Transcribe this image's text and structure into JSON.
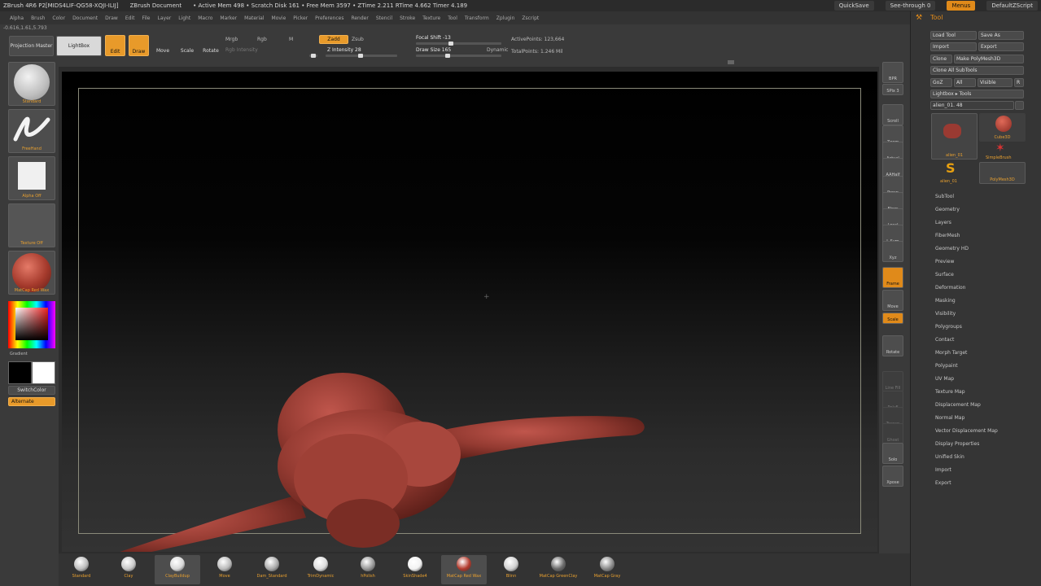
{
  "titlebar": {
    "app": "ZBrush 4R6 P2[MIDS4LIF-QG58-XQJI-ILIJ]",
    "doc": "ZBrush Document",
    "stats": "• Active Mem 498 • Scratch Disk 161 • Free Mem 3597 • ZTime 2.211 RTime 4.662 Timer 4.189",
    "quicksave": "QuickSave",
    "seethrough": "See-through 0",
    "menus": "Menus",
    "script": "DefaultZScript"
  },
  "menubar": [
    "Alpha",
    "Brush",
    "Color",
    "Document",
    "Draw",
    "Edit",
    "File",
    "Layer",
    "Light",
    "Macro",
    "Marker",
    "Material",
    "Movie",
    "Picker",
    "Preferences",
    "Render",
    "Stencil",
    "Stroke",
    "Texture",
    "Tool",
    "Transform",
    "Zplugin",
    "Zscript"
  ],
  "coords": "-0.616,1.61,5.793",
  "shelf": {
    "projection_master": "Projection Master",
    "lightbox": "LightBox",
    "edit": "Edit",
    "draw": "Draw",
    "move": "Move",
    "scale": "Scale",
    "rotate": "Rotate",
    "mrgb": "Mrgb",
    "rgb": "Rgb",
    "m": "M",
    "rgb_intensity": "Rgb Intensity",
    "zadd": "Zadd",
    "zsub": "Zsub",
    "z_intensity": "Z Intensity 28",
    "focal_shift": "Focal Shift -13",
    "draw_size": "Draw Size 165",
    "dynamic": "Dynamic",
    "active_points": "ActivePoints: 123,664",
    "total_points": "TotalPoints: 1.246 Mil"
  },
  "left": {
    "brush": "Standard",
    "stroke": "FreeHand",
    "alpha": "Alpha Off",
    "texture": "Texture Off",
    "material": "MatCap Red Wax",
    "gradient": "Gradient",
    "switch_color": "SwitchColor",
    "alternate": "Alternate"
  },
  "right_strip": [
    "BPR",
    "SPix 3",
    "Scroll",
    "Zoom",
    "Actual",
    "AAHalf",
    "Persp",
    "Floor",
    "Local",
    "L.Sym",
    "Xyz",
    "Frame",
    "Move",
    "Scale",
    "Rotate",
    "Line Fill",
    "PolyF",
    "Transp",
    "Ghost",
    "Solo",
    "Xpose"
  ],
  "tool": {
    "title": "Tool",
    "buttons": [
      "Load Tool",
      "Save As",
      "Import",
      "Export",
      "Clone",
      "Make PolyMesh3D",
      "Clone All SubTools",
      "GoZ",
      "All",
      "Visible",
      "R",
      "Lightbox ▸ Tools",
      "alien_01. 48"
    ],
    "tiles": [
      "alien_01",
      "Cube3D",
      "SimpleBrush",
      "alien_01",
      "PolyMesh3D"
    ],
    "items": [
      "SubTool",
      "Geometry",
      "Layers",
      "FiberMesh",
      "Geometry HD",
      "Preview",
      "Surface",
      "Deformation",
      "Masking",
      "Visibility",
      "Polygroups",
      "Contact",
      "Morph Target",
      "Polypaint",
      "UV Map",
      "Texture Map",
      "Displacement Map",
      "Normal Map",
      "Vector Displacement Map",
      "Display Properties",
      "Unified Skin",
      "Import",
      "Export"
    ]
  },
  "materials": [
    "Standard",
    "Clay",
    "ClayBuildup",
    "Move",
    "Dam_Standard",
    "TrimDynamic",
    "hPolish",
    "SkinShade4",
    "MatCap Red Wax",
    "Blinn",
    "MatCap GreenClay",
    "MatCap Gray"
  ],
  "colors": {
    "accent": "#e08a1a",
    "model": "#9a3a32",
    "panel": "#3a3a3a"
  }
}
